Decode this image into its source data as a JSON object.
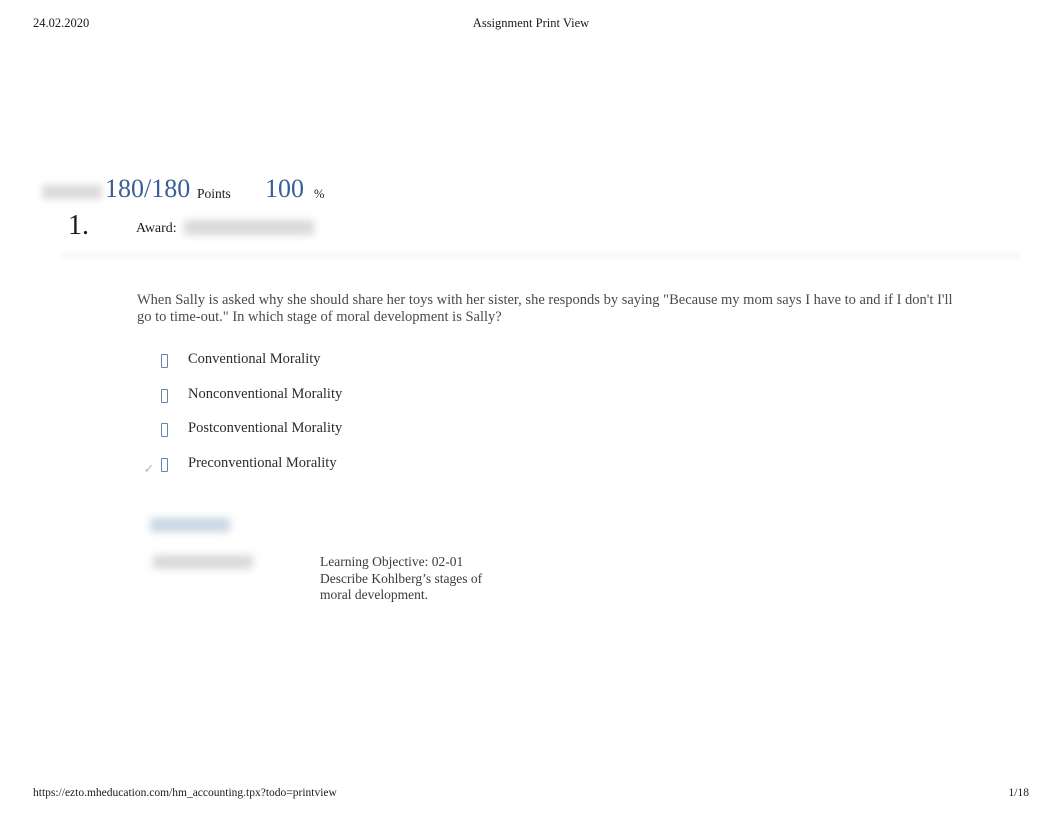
{
  "header": {
    "date": "24.02.2020",
    "title": "Assignment Print View"
  },
  "score": {
    "label_redacted": "",
    "points": "180/180",
    "points_unit": "Points",
    "percent": "100",
    "percent_unit": "%",
    "accent_color": "#3a5f96"
  },
  "question": {
    "number": "1.",
    "award_label": "Award:",
    "award_value_redacted": "",
    "stem": "When Sally is asked why she should share her toys with her sister, she responds by saying \"Because my mom says I have to and if I don't I'll go to time-out.\" In which stage of moral development is Sally?",
    "options": [
      {
        "label": "Conventional Morality",
        "selected": false,
        "marker": "radio-glyph"
      },
      {
        "label": "Nonconventional Morality",
        "selected": false,
        "marker": "radio-glyph"
      },
      {
        "label": "Postconventional Morality",
        "selected": false,
        "marker": "radio-glyph"
      },
      {
        "label": "Preconventional Morality",
        "selected": true,
        "marker": "radio-glyph"
      }
    ],
    "correct_mark": "✓"
  },
  "metadata": {
    "blurred_link_redacted": "",
    "blurred_tag_redacted": "",
    "learning_objective_line1": "Learning Objective: 02-01",
    "learning_objective_line2": "Describe Kohlberg’s stages of",
    "learning_objective_line3": "moral development."
  },
  "footer": {
    "url": "https://ezto.mheducation.com/hm_accounting.tpx?todo=printview",
    "page": "1/18"
  }
}
